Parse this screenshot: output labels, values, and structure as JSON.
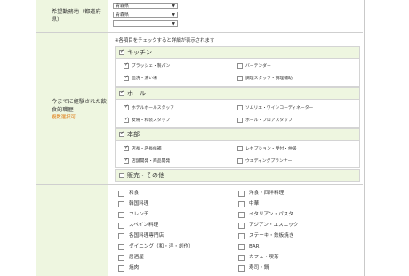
{
  "desired_location": {
    "label": "希望勤務地（都道府県）",
    "select1": "青森県",
    "select2": "青森県",
    "select3": ""
  },
  "experience": {
    "label": "今までに経験された飲食的職歴",
    "note_multi": "複数選択可",
    "hint": "※各項目をチェックすると詳細が表示されます",
    "groups": [
      {
        "name": "キッチン",
        "checked": true,
        "items": [
          {
            "label": "ブラッシェ・製パン",
            "checked": true
          },
          {
            "label": "バーテンダー",
            "checked": false
          },
          {
            "label": "皿洗・洗い場",
            "checked": true
          },
          {
            "label": "調理スタッフ・調理補助",
            "checked": false
          }
        ]
      },
      {
        "name": "ホール",
        "checked": true,
        "items": [
          {
            "label": "ホテルホールスタッフ",
            "checked": true
          },
          {
            "label": "ソムリエ・ワインコーディネーター",
            "checked": false
          },
          {
            "label": "女将・和装スタッフ",
            "checked": true
          },
          {
            "label": "ホール・フロアスタッフ",
            "checked": false
          }
        ]
      },
      {
        "name": "本部",
        "checked": true,
        "items": [
          {
            "label": "店長・店長候補",
            "checked": true
          },
          {
            "label": "レセプション・受付・仲居",
            "checked": false
          },
          {
            "label": "店舗開発・商品開発",
            "checked": true
          },
          {
            "label": "ウエディングプランナー",
            "checked": false
          }
        ]
      },
      {
        "name": "販売・その他",
        "checked": false,
        "items": []
      }
    ]
  },
  "genres": {
    "left": [
      "和食",
      "韓国料理",
      "フレンチ",
      "スペイン料理",
      "各国料理専門店",
      "ダイニング（和・洋・創作）",
      "居酒屋",
      "焼肉"
    ],
    "right": [
      "洋食・西洋料理",
      "中華",
      "イタリアン・パスタ",
      "アジアン・エスニック",
      "ステーキ・鉄板焼き",
      "BAR",
      "カフェ・喫茶",
      "寿司・鍋"
    ]
  }
}
